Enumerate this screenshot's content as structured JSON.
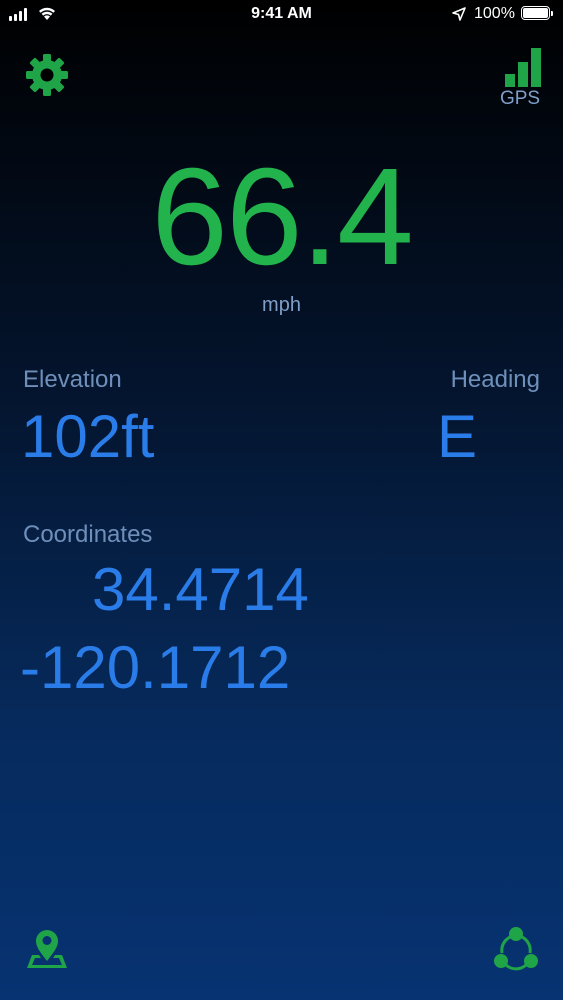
{
  "status_bar": {
    "time": "9:41 AM",
    "battery_percent": "100%"
  },
  "header": {
    "gps_label": "GPS",
    "gps_signal_bars": 3,
    "settings_icon": "gear-icon"
  },
  "speed": {
    "value": "66.4",
    "unit": "mph"
  },
  "elevation": {
    "label": "Elevation",
    "value": "102ft"
  },
  "heading": {
    "label": "Heading",
    "value": "E"
  },
  "coordinates": {
    "label": "Coordinates",
    "latitude": "34.4714",
    "longitude": "-120.1712"
  },
  "footer": {
    "map_icon": "map-pin-icon",
    "share_icon": "share-icon"
  },
  "colors": {
    "accent_green": "#22b34d",
    "value_blue": "#2a7de9",
    "label_blue": "#6f8fbb"
  }
}
